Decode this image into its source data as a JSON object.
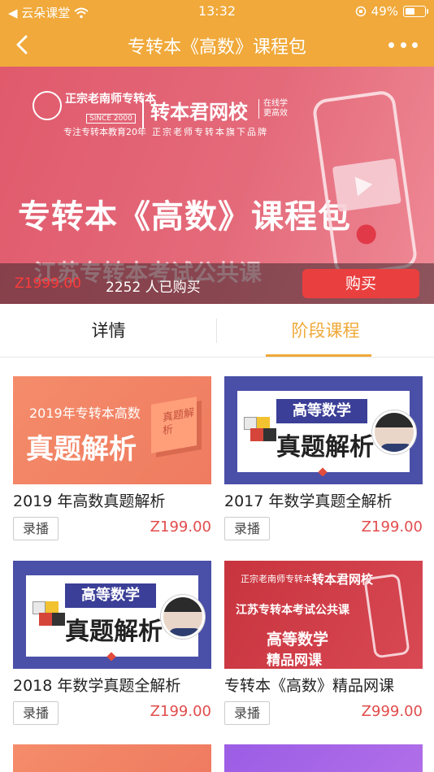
{
  "status_bar": {
    "carrier": "◀ 云朵课堂",
    "time": "13:32",
    "battery": "49%",
    "battery_level": 0.49
  },
  "nav": {
    "title": "专转本《高数》课程包"
  },
  "banner": {
    "logo_line1": "正宗老南师专转本",
    "logo_since": "SINCE 2000",
    "logo_line2": "专注专转本教育20年",
    "brand": "转本君网校",
    "brand_tag_1": "在线学",
    "brand_tag_2": "更高效",
    "brand_sub": "正宗老师专转本旗下品牌",
    "headline": "专转本《高数》课程包",
    "subline": "江苏专转本考试公共课"
  },
  "price_bar": {
    "price": "Z1999.00",
    "bought": "2252 人已购买",
    "buy_label": "购买"
  },
  "tabs": [
    {
      "label": "详情"
    },
    {
      "label": "阶段课程"
    }
  ],
  "courses": [
    {
      "name": "2019 年高数真题解析",
      "tag": "录播",
      "price": "Z199.00",
      "thumb_top": "2019年专转本高数",
      "thumb_big": "真题解析",
      "thumb_box": "真题解析"
    },
    {
      "name": "2017 年数学真题全解析",
      "tag": "录播",
      "price": "Z199.00",
      "thumb_ribbon": "高等数学",
      "thumb_big": "真题解析"
    },
    {
      "name": "2018 年数学真题全解析",
      "tag": "录播",
      "price": "Z199.00",
      "thumb_ribbon": "高等数学",
      "thumb_big": "真题解析"
    },
    {
      "name": "专转本《高数》精品网课",
      "tag": "录播",
      "price": "Z999.00",
      "thumb_brand_small": "正宗老南师专转本",
      "thumb_brand": "转本君网校",
      "thumb_line1": "江苏专转本考试公共课",
      "thumb_line2": "高等数学",
      "thumb_line3": "精品网课"
    }
  ],
  "colors": {
    "accent": "#f0a93a",
    "buy_button": "#ea3f3f",
    "price_red": "#e24c4c"
  }
}
